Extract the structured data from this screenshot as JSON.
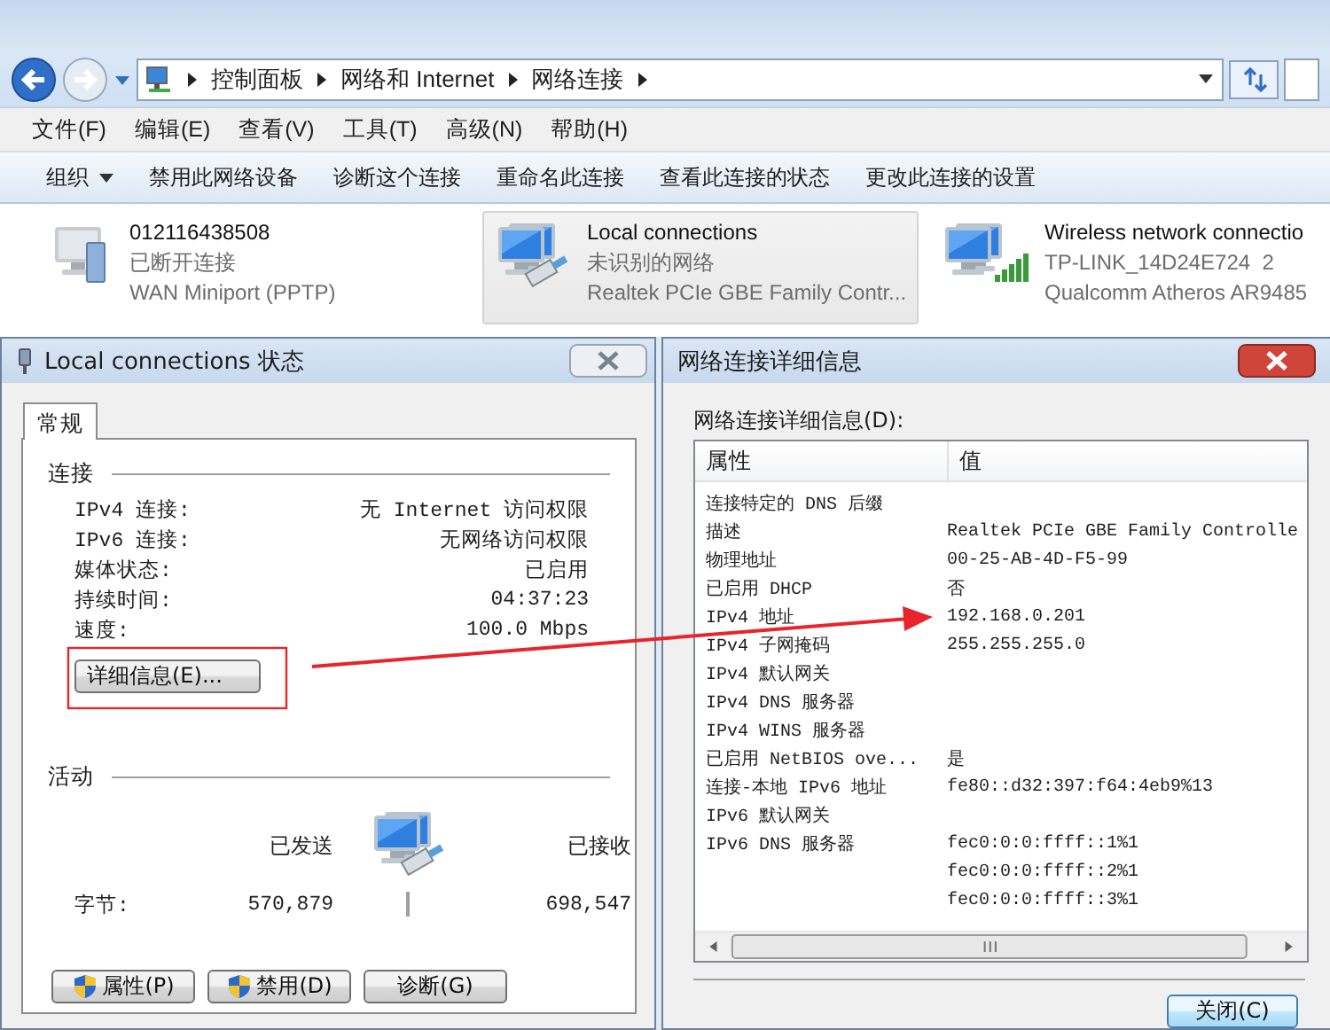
{
  "explorer": {
    "breadcrumb": [
      "控制面板",
      "网络和 Internet",
      "网络连接"
    ],
    "menu": [
      "文件(F)",
      "编辑(E)",
      "查看(V)",
      "工具(T)",
      "高级(N)",
      "帮助(H)"
    ],
    "toolbar": [
      {
        "label": "组织",
        "kind": "dropdown"
      },
      {
        "label": "禁用此网络设备",
        "kind": "command"
      },
      {
        "label": "诊断这个连接",
        "kind": "command"
      },
      {
        "label": "重命名此连接",
        "kind": "command"
      },
      {
        "label": "查看此连接的状态",
        "kind": "command"
      },
      {
        "label": "更改此连接的设置",
        "kind": "command"
      }
    ],
    "connections": [
      {
        "name": "012116438508",
        "status": "已断开连接",
        "device": "WAN Miniport (PPTP)",
        "kind": "wan",
        "selected": false
      },
      {
        "name": "Local connections",
        "status": "未识别的网络",
        "device": "Realtek PCIe GBE Family Contr...",
        "kind": "ethernet",
        "selected": true
      },
      {
        "name": "Wireless network connectio",
        "status": "TP-LINK_14D24E724  2",
        "device": "Qualcomm Atheros AR9485",
        "kind": "wireless",
        "selected": false
      }
    ]
  },
  "status_dialog": {
    "title": "Local connections 状态",
    "tabs": [
      {
        "label": "常规",
        "selected": true
      }
    ],
    "connection_heading": "连接",
    "fields": [
      {
        "label": "IPv4 连接:",
        "value": "无 Internet 访问权限"
      },
      {
        "label": "IPv6 连接:",
        "value": "无网络访问权限"
      },
      {
        "label": "媒体状态:",
        "value": "已启用"
      },
      {
        "label": "持续时间:",
        "value": "04:37:23"
      },
      {
        "label": "速度:",
        "value": "100.0 Mbps"
      }
    ],
    "details_button": "详细信息(E)...",
    "activity_heading": "活动",
    "sent_label": "已发送",
    "received_label": "已接收",
    "bytes_label": "字节:",
    "bytes_sent": "570,879",
    "bytes_received": "698,547",
    "buttons": [
      {
        "label": "属性(P)",
        "shield": true
      },
      {
        "label": "禁用(D)",
        "shield": true
      },
      {
        "label": "诊断(G)",
        "shield": false
      }
    ]
  },
  "details_dialog": {
    "title": "网络连接详细信息",
    "list_label": "网络连接详细信息(D):",
    "columns": [
      "属性",
      "值"
    ],
    "rows": [
      {
        "property": "连接特定的 DNS 后缀"
      },
      {
        "property": "描述",
        "value": "Realtek PCIe GBE Family Controlle"
      },
      {
        "property": "物理地址",
        "value": "00-25-AB-4D-F5-99"
      },
      {
        "property": "已启用 DHCP",
        "value": "否"
      },
      {
        "property": "IPv4 地址",
        "value": "192.168.0.201"
      },
      {
        "property": "IPv4 子网掩码",
        "value": "255.255.255.0"
      },
      {
        "property": "IPv4 默认网关"
      },
      {
        "property": "IPv4 DNS 服务器"
      },
      {
        "property": "IPv4 WINS 服务器"
      },
      {
        "property": "已启用 NetBIOS ove...",
        "value": "是"
      },
      {
        "property": "连接-本地 IPv6 地址",
        "value": "fe80::d32:397:f64:4eb9%13"
      },
      {
        "property": "IPv6 默认网关"
      },
      {
        "property": "IPv6 DNS 服务器",
        "value": "fec0:0:0:ffff::1%1"
      },
      {
        "value": "fec0:0:0:ffff::2%1"
      },
      {
        "value": "fec0:0:0:ffff::3%1"
      }
    ],
    "close_button": "关闭(C)"
  }
}
